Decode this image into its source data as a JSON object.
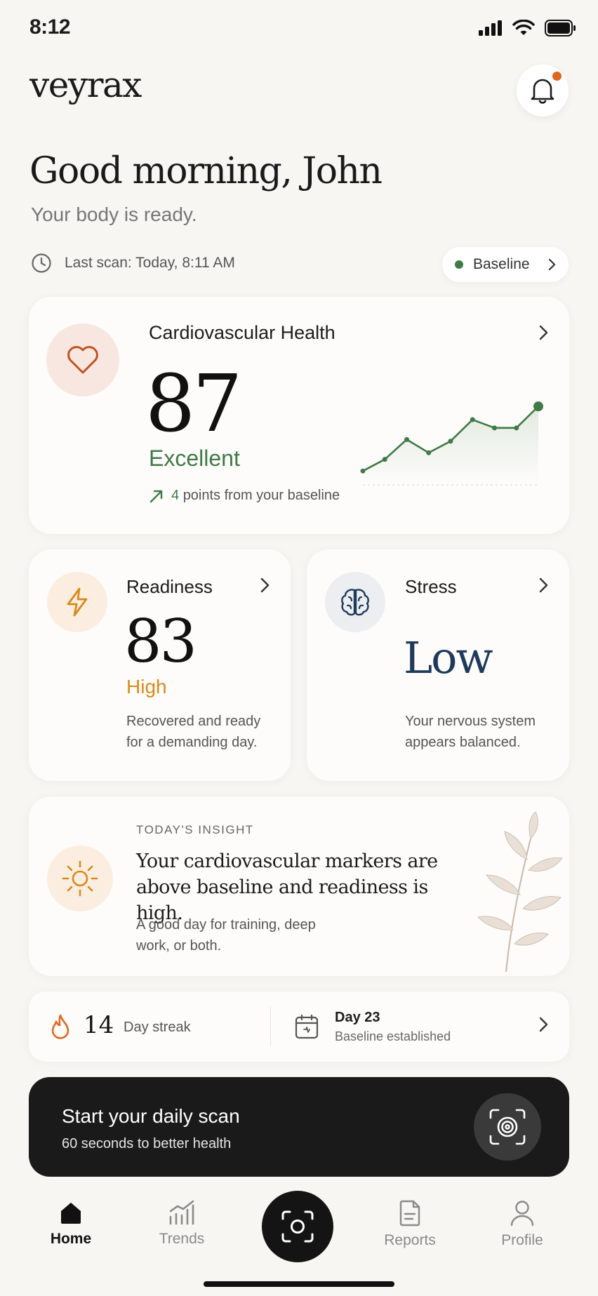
{
  "status": {
    "time": "8:12"
  },
  "header": {
    "logo": "veyrax"
  },
  "greeting": {
    "title": "Good morning, John",
    "subtitle": "Your body is ready."
  },
  "scan_info": {
    "last_scan": "Last scan: Today, 8:11 AM",
    "baseline_label": "Baseline"
  },
  "cardio": {
    "title": "Cardiovascular Health",
    "score": "87",
    "status": "Excellent",
    "delta_num": "4",
    "delta_text": "points from your baseline",
    "trend": [
      10,
      24,
      48,
      32,
      46,
      72,
      62,
      62,
      88
    ]
  },
  "readiness": {
    "title": "Readiness",
    "score": "83",
    "level": "High",
    "desc": "Recovered and ready for a demanding day."
  },
  "stress": {
    "title": "Stress",
    "level": "Low",
    "desc": "Your nervous system appears balanced."
  },
  "insight": {
    "label": "TODAY'S INSIGHT",
    "text": "Your cardiovascular markers are above baseline and readiness is high.",
    "sub": "A good day for training, deep work, or both."
  },
  "streak": {
    "count": "14",
    "label": "Day streak",
    "day_title": "Day 23",
    "day_sub": "Baseline established"
  },
  "scan_cta": {
    "title": "Start your daily scan",
    "subtitle": "60 seconds to better health"
  },
  "tabs": {
    "home": "Home",
    "trends": "Trends",
    "reports": "Reports",
    "profile": "Profile"
  },
  "colors": {
    "accent_green": "#3f7a47",
    "accent_orange": "#d98a1b",
    "notification": "#e0671f",
    "stress_navy": "#1f3a5a"
  }
}
